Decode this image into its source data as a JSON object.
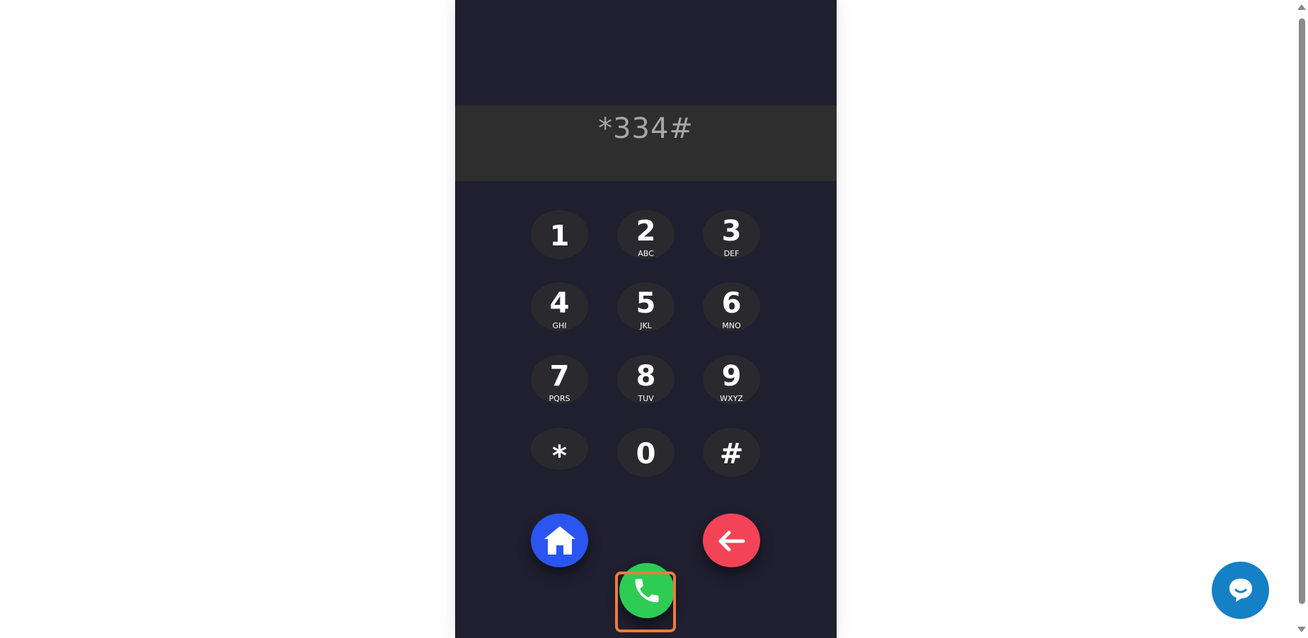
{
  "display": {
    "value": "*334#"
  },
  "keypad": [
    {
      "digit": "1",
      "letters": ""
    },
    {
      "digit": "2",
      "letters": "ABC"
    },
    {
      "digit": "3",
      "letters": "DEF"
    },
    {
      "digit": "4",
      "letters": "GHI"
    },
    {
      "digit": "5",
      "letters": "JKL"
    },
    {
      "digit": "6",
      "letters": "MNO"
    },
    {
      "digit": "7",
      "letters": "PQRS"
    },
    {
      "digit": "8",
      "letters": "TUV"
    },
    {
      "digit": "9",
      "letters": "WXYZ"
    },
    {
      "digit": "*",
      "letters": ""
    },
    {
      "digit": "0",
      "letters": ""
    },
    {
      "digit": "#",
      "letters": ""
    }
  ],
  "actions": {
    "home_icon": "home-icon",
    "back_icon": "arrow-left-icon",
    "call_icon": "phone-icon"
  },
  "colors": {
    "phone_bg": "#1f1f2f",
    "display_bg": "#2e2e2e",
    "key_bg": "#2a2a2e",
    "home": "#2b55f0",
    "back": "#f24456",
    "call": "#2ecc55",
    "highlight": "#f07a3e",
    "chat": "#1480c6"
  },
  "chat": {
    "icon": "chat-bubble-icon"
  }
}
